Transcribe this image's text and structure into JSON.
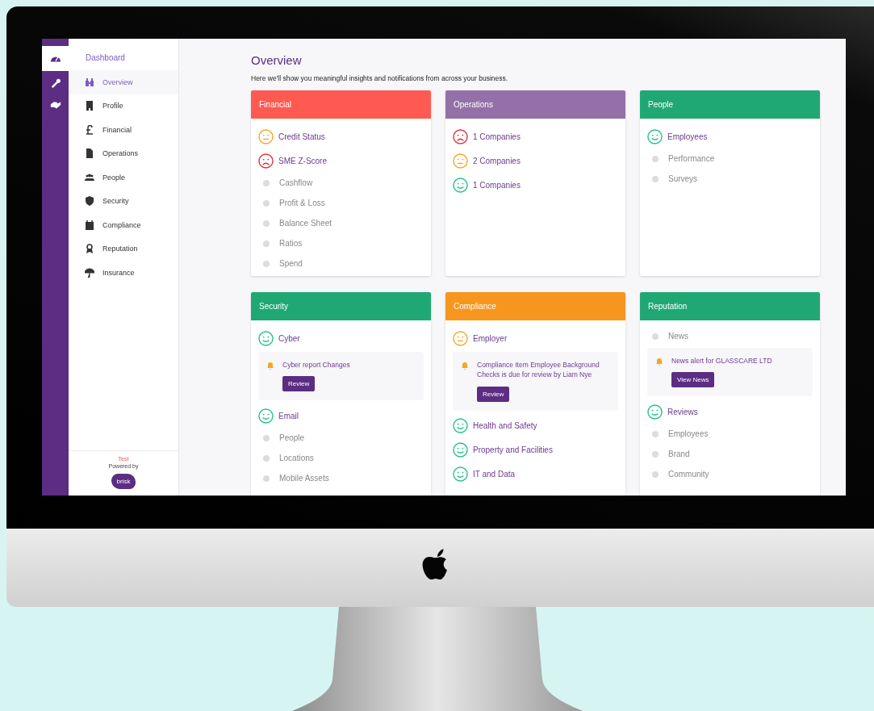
{
  "rail": [
    {
      "selected": true
    },
    {
      "selected": false
    },
    {
      "selected": false
    }
  ],
  "sidebar": {
    "heading": "Dashboard",
    "items": [
      {
        "label": "Overview",
        "selected": true
      },
      {
        "label": "Profile",
        "selected": false
      },
      {
        "label": "Financial",
        "selected": false
      },
      {
        "label": "Operations",
        "selected": false
      },
      {
        "label": "People",
        "selected": false
      },
      {
        "label": "Security",
        "selected": false
      },
      {
        "label": "Compliance",
        "selected": false
      },
      {
        "label": "Reputation",
        "selected": false
      },
      {
        "label": "Insurance",
        "selected": false
      }
    ],
    "footer": {
      "tag": "Test",
      "powered_by": "Powered by",
      "logo": "brisk"
    }
  },
  "main": {
    "title": "Overview",
    "subtitle": "Here we'll show you meaningful insights and notifications from across your business.",
    "cards": [
      {
        "title": "Financial",
        "color": "#ff5a52",
        "items": [
          {
            "kind": "neutral",
            "label": "Credit Status"
          },
          {
            "kind": "bad",
            "label": "SME Z-Score"
          },
          {
            "kind": "pending",
            "label": "Cashflow"
          },
          {
            "kind": "pending",
            "label": "Profit & Loss"
          },
          {
            "kind": "pending",
            "label": "Balance Sheet"
          },
          {
            "kind": "pending",
            "label": "Ratios"
          },
          {
            "kind": "pending",
            "label": "Spend"
          }
        ]
      },
      {
        "title": "Operations",
        "color": "#9470a8",
        "items": [
          {
            "kind": "bad",
            "label": "1 Companies"
          },
          {
            "kind": "neutral",
            "label": "2 Companies"
          },
          {
            "kind": "good",
            "label": "1 Companies"
          }
        ]
      },
      {
        "title": "People",
        "color": "#20a874",
        "items": [
          {
            "kind": "good",
            "label": "Employees"
          },
          {
            "kind": "pending",
            "label": "Performance"
          },
          {
            "kind": "pending",
            "label": "Surveys"
          }
        ]
      },
      {
        "title": "Security",
        "color": "#20a874",
        "items": [
          {
            "kind": "good",
            "label": "Cyber"
          },
          {
            "kind": "alert",
            "text": "Cyber report Changes",
            "button": "Review"
          },
          {
            "kind": "good",
            "label": "Email"
          },
          {
            "kind": "pending",
            "label": "People"
          },
          {
            "kind": "pending",
            "label": "Locations"
          },
          {
            "kind": "pending",
            "label": "Mobile Assets"
          }
        ]
      },
      {
        "title": "Compliance",
        "color": "#f7961f",
        "items": [
          {
            "kind": "neutral",
            "label": "Employer"
          },
          {
            "kind": "alert",
            "text": "Compliance Item Employee Background Checks is due for review by Liam Nye",
            "button": "Review"
          },
          {
            "kind": "good",
            "label": "Health and Safety"
          },
          {
            "kind": "good",
            "label": "Property and Facilities"
          },
          {
            "kind": "good",
            "label": "IT and Data"
          }
        ]
      },
      {
        "title": "Reputation",
        "color": "#20a874",
        "items": [
          {
            "kind": "pending",
            "label": "News"
          },
          {
            "kind": "alert",
            "text": "News alert for GLASSCARE LTD",
            "button": "View News"
          },
          {
            "kind": "good",
            "label": "Reviews"
          },
          {
            "kind": "pending",
            "label": "Employees"
          },
          {
            "kind": "pending",
            "label": "Brand"
          },
          {
            "kind": "pending",
            "label": "Community"
          }
        ]
      }
    ]
  }
}
